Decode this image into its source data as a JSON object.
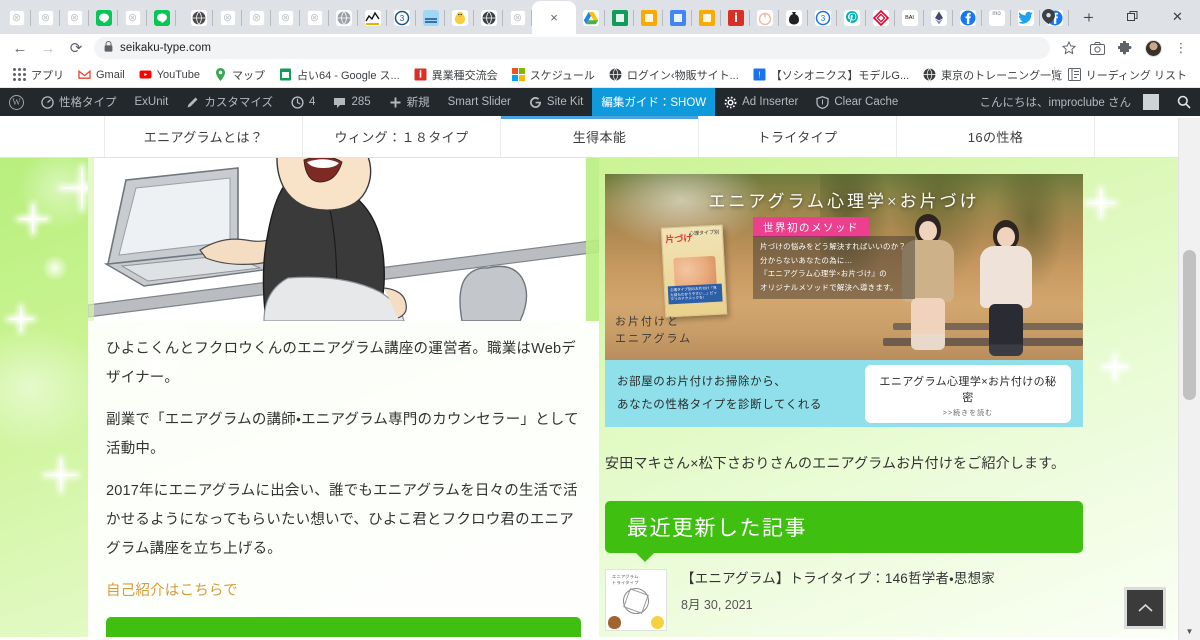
{
  "browser": {
    "tabs_left": [
      {
        "icon": "broken-favicon",
        "title": ""
      },
      {
        "icon": "broken-favicon",
        "title": ""
      },
      {
        "icon": "broken-favicon",
        "title": ""
      },
      {
        "icon": "line-messenger-favicon",
        "title": ""
      },
      {
        "icon": "broken-favicon",
        "title": ""
      },
      {
        "icon": "line-messenger-favicon",
        "title": ""
      }
    ],
    "tabs_mid": [
      {
        "icon": "dark-circle-favicon",
        "title": ""
      },
      {
        "icon": "broken-favicon",
        "title": ""
      },
      {
        "icon": "broken-favicon",
        "title": ""
      },
      {
        "icon": "broken-favicon",
        "title": ""
      },
      {
        "icon": "broken-favicon",
        "title": ""
      },
      {
        "icon": "grey-circle-favicon",
        "title": ""
      },
      {
        "icon": "chart-favicon",
        "title": ""
      },
      {
        "icon": "blue-square-favicon",
        "title": ""
      },
      {
        "icon": "rain-favicon",
        "title": ""
      },
      {
        "icon": "chick-favicon",
        "title": ""
      },
      {
        "icon": "globe-favicon",
        "title": ""
      },
      {
        "icon": "broken-favicon",
        "title": ""
      }
    ],
    "active_tab": {
      "icon": "close-icon",
      "title": "×"
    },
    "tabs_right": [
      {
        "icon": "google-drive-favicon",
        "title": ""
      },
      {
        "icon": "google-sheets-favicon",
        "title": ""
      },
      {
        "icon": "yellow-square-favicon",
        "title": ""
      },
      {
        "icon": "google-docs-favicon",
        "title": ""
      },
      {
        "icon": "yellow-square-favicon",
        "title": ""
      },
      {
        "icon": "indeed-favicon",
        "title": ""
      },
      {
        "icon": "peach-favicon",
        "title": ""
      },
      {
        "icon": "moneybag-favicon",
        "title": ""
      },
      {
        "icon": "blue-badge-favicon",
        "title": ""
      },
      {
        "icon": "pinterest-favicon",
        "title": ""
      },
      {
        "icon": "red-diamond-favicon",
        "title": ""
      },
      {
        "icon": "bai-favicon",
        "title": ""
      },
      {
        "icon": "ethereum-favicon",
        "title": ""
      },
      {
        "icon": "facebook-favicon",
        "title": ""
      },
      {
        "icon": "mo-pure-favicon",
        "title": ""
      },
      {
        "icon": "twitter-favicon",
        "title": ""
      },
      {
        "icon": "facebook-favicon",
        "title": ""
      }
    ],
    "new_tab_label": "+",
    "window_controls": {
      "minimize": "–",
      "maximize": "▢",
      "close": "✕"
    },
    "nav": {
      "back": "←",
      "forward": "→",
      "reload": "⟳"
    },
    "omnibox": {
      "lock": "🔒",
      "url": "seikaku-type.com"
    },
    "toolbar_right": [
      {
        "name": "bookmark-star-icon",
        "glyph": "☆"
      },
      {
        "name": "screenshot-camera-icon",
        "glyph": "▣"
      },
      {
        "name": "extensions-puzzle-icon",
        "glyph": "🧩"
      },
      {
        "name": "profile-avatar",
        "glyph": ""
      },
      {
        "name": "chrome-menu-icon",
        "glyph": "⋮"
      }
    ],
    "bookmarks": [
      {
        "name": "apps-grid",
        "label": "アプリ",
        "color": "#5f6368"
      },
      {
        "name": "gmail",
        "label": "Gmail",
        "color": "#ea4335"
      },
      {
        "name": "youtube",
        "label": "YouTube",
        "color": "#ff0000"
      },
      {
        "name": "maps",
        "label": "マップ",
        "color": "#34a853"
      },
      {
        "name": "google-sheets",
        "label": "占い64 - Google ス...",
        "color": "#0f9d58"
      },
      {
        "name": "red-info",
        "label": "異業種交流会",
        "color": "#d93025"
      },
      {
        "name": "microsoft",
        "label": "スケジュール",
        "color": "#0078d4"
      },
      {
        "name": "globe-dark",
        "label": "ログイン‹物販サイト...",
        "color": "#3c4043"
      },
      {
        "name": "blue-badge",
        "label": "【ソシオニクス】モデルG...",
        "color": "#1a73e8"
      },
      {
        "name": "globe-dark2",
        "label": "東京のトレーニング一覧",
        "color": "#3c4043"
      }
    ],
    "reading_list": {
      "icon": "reading-list-icon",
      "label": "リーディング リスト"
    }
  },
  "wp_admin_bar": {
    "logo": "wordpress-logo",
    "items": [
      {
        "name": "site-name",
        "icon": "dashboard-icon",
        "label": "性格タイプ"
      },
      {
        "name": "exunit",
        "icon": "",
        "label": "ExUnit"
      },
      {
        "name": "customize",
        "icon": "pencil-icon",
        "label": "カスタマイズ"
      },
      {
        "name": "updates",
        "icon": "update-icon",
        "label": "4"
      },
      {
        "name": "comments",
        "icon": "comment-icon",
        "label": "285"
      },
      {
        "name": "new",
        "icon": "plus-icon",
        "label": "新規"
      },
      {
        "name": "smart-slider",
        "icon": "",
        "label": "Smart Slider"
      },
      {
        "name": "site-kit",
        "icon": "google-g-icon",
        "label": "Site Kit"
      },
      {
        "name": "edit-guide",
        "icon": "",
        "label": "編集ガイド：SHOW",
        "highlight": true
      },
      {
        "name": "ad-inserter",
        "icon": "gear-icon",
        "label": "Ad Inserter"
      },
      {
        "name": "clear-cache",
        "icon": "shield-icon",
        "label": "Clear Cache"
      }
    ],
    "greeting": "こんにちは、improclube さん",
    "search_icon": "search-icon"
  },
  "site_nav": {
    "items": [
      {
        "label": "エニアグラムとは？",
        "active": false
      },
      {
        "label": "ウィング：１８タイプ",
        "active": false
      },
      {
        "label": "生得本能",
        "active": true
      },
      {
        "label": "トライタイプ",
        "active": false
      },
      {
        "label": "16の性格",
        "active": false
      }
    ]
  },
  "main": {
    "hero_image_alt": "laptop-illustration",
    "paragraphs": [
      "ひよこくんとフクロウくんのエニアグラム講座の運営者。職業はWebデザイナー。",
      "副業で「エニアグラムの講師・エニアグラム専門のカウンセラー」として活動中。",
      "2017年にエニアグラムに出会い、誰でもエニアグラムを日々の生活で活かせるようになってもらいたい想いで、ひよこ君とフクロウ君のエニアグラム講座を立ち上げる。"
    ],
    "profile_link": "自己紹介はこちらで",
    "cta_button_label": ""
  },
  "sidebar": {
    "banner": {
      "title": "エニアグラム心理学×お片づけ",
      "badge": "世界初のメソッド",
      "copy_lines": [
        "片づけの悩みをどう解決すればいいのか？",
        "分からないあなたの為に…",
        "『エニアグラム心理学×お片づけ』の",
        "オリジナルメソッドで解決へ導きます。"
      ],
      "side_text_line1": "お片付けと",
      "side_text_line2": "エニアグラム",
      "book_title_1": "片づけ",
      "book_title_2": "心理タイプ別",
      "book_title_3": "術",
      "book_sub": "心理タイプ別のお片付け「見た目もわかりやすい…」ピッタリのテクニックを!",
      "bottom_line1": "お部屋のお片付けお掃除から、",
      "bottom_line2": "あなたの性格タイプを診断してくれる",
      "cta_title": "エニアグラム心理学×お片付けの秘密",
      "cta_more": ">>続きを読む"
    },
    "caption": "安田マキさん×松下さおりさんのエニアグラムお片付けをご紹介します。",
    "section_heading": "最近更新した記事",
    "posts": [
      {
        "thumb_label_1": "エニアグラム",
        "thumb_label_2": "トライタイプ",
        "title": "【エニアグラム】トライタイプ：146哲学者・思想家",
        "date": "8月 30, 2021"
      }
    ]
  },
  "controls": {
    "scroll_to_top": "⌃",
    "scrollbar_down_arrow": "▼"
  },
  "colors": {
    "wp_bar": "#23282d",
    "wp_highlight": "#0f9bdb",
    "site_green": "#3fc011",
    "nav_active": "#4aa3df",
    "banner_cyan": "#8fe0ea",
    "link_orange": "#d99b3a"
  }
}
